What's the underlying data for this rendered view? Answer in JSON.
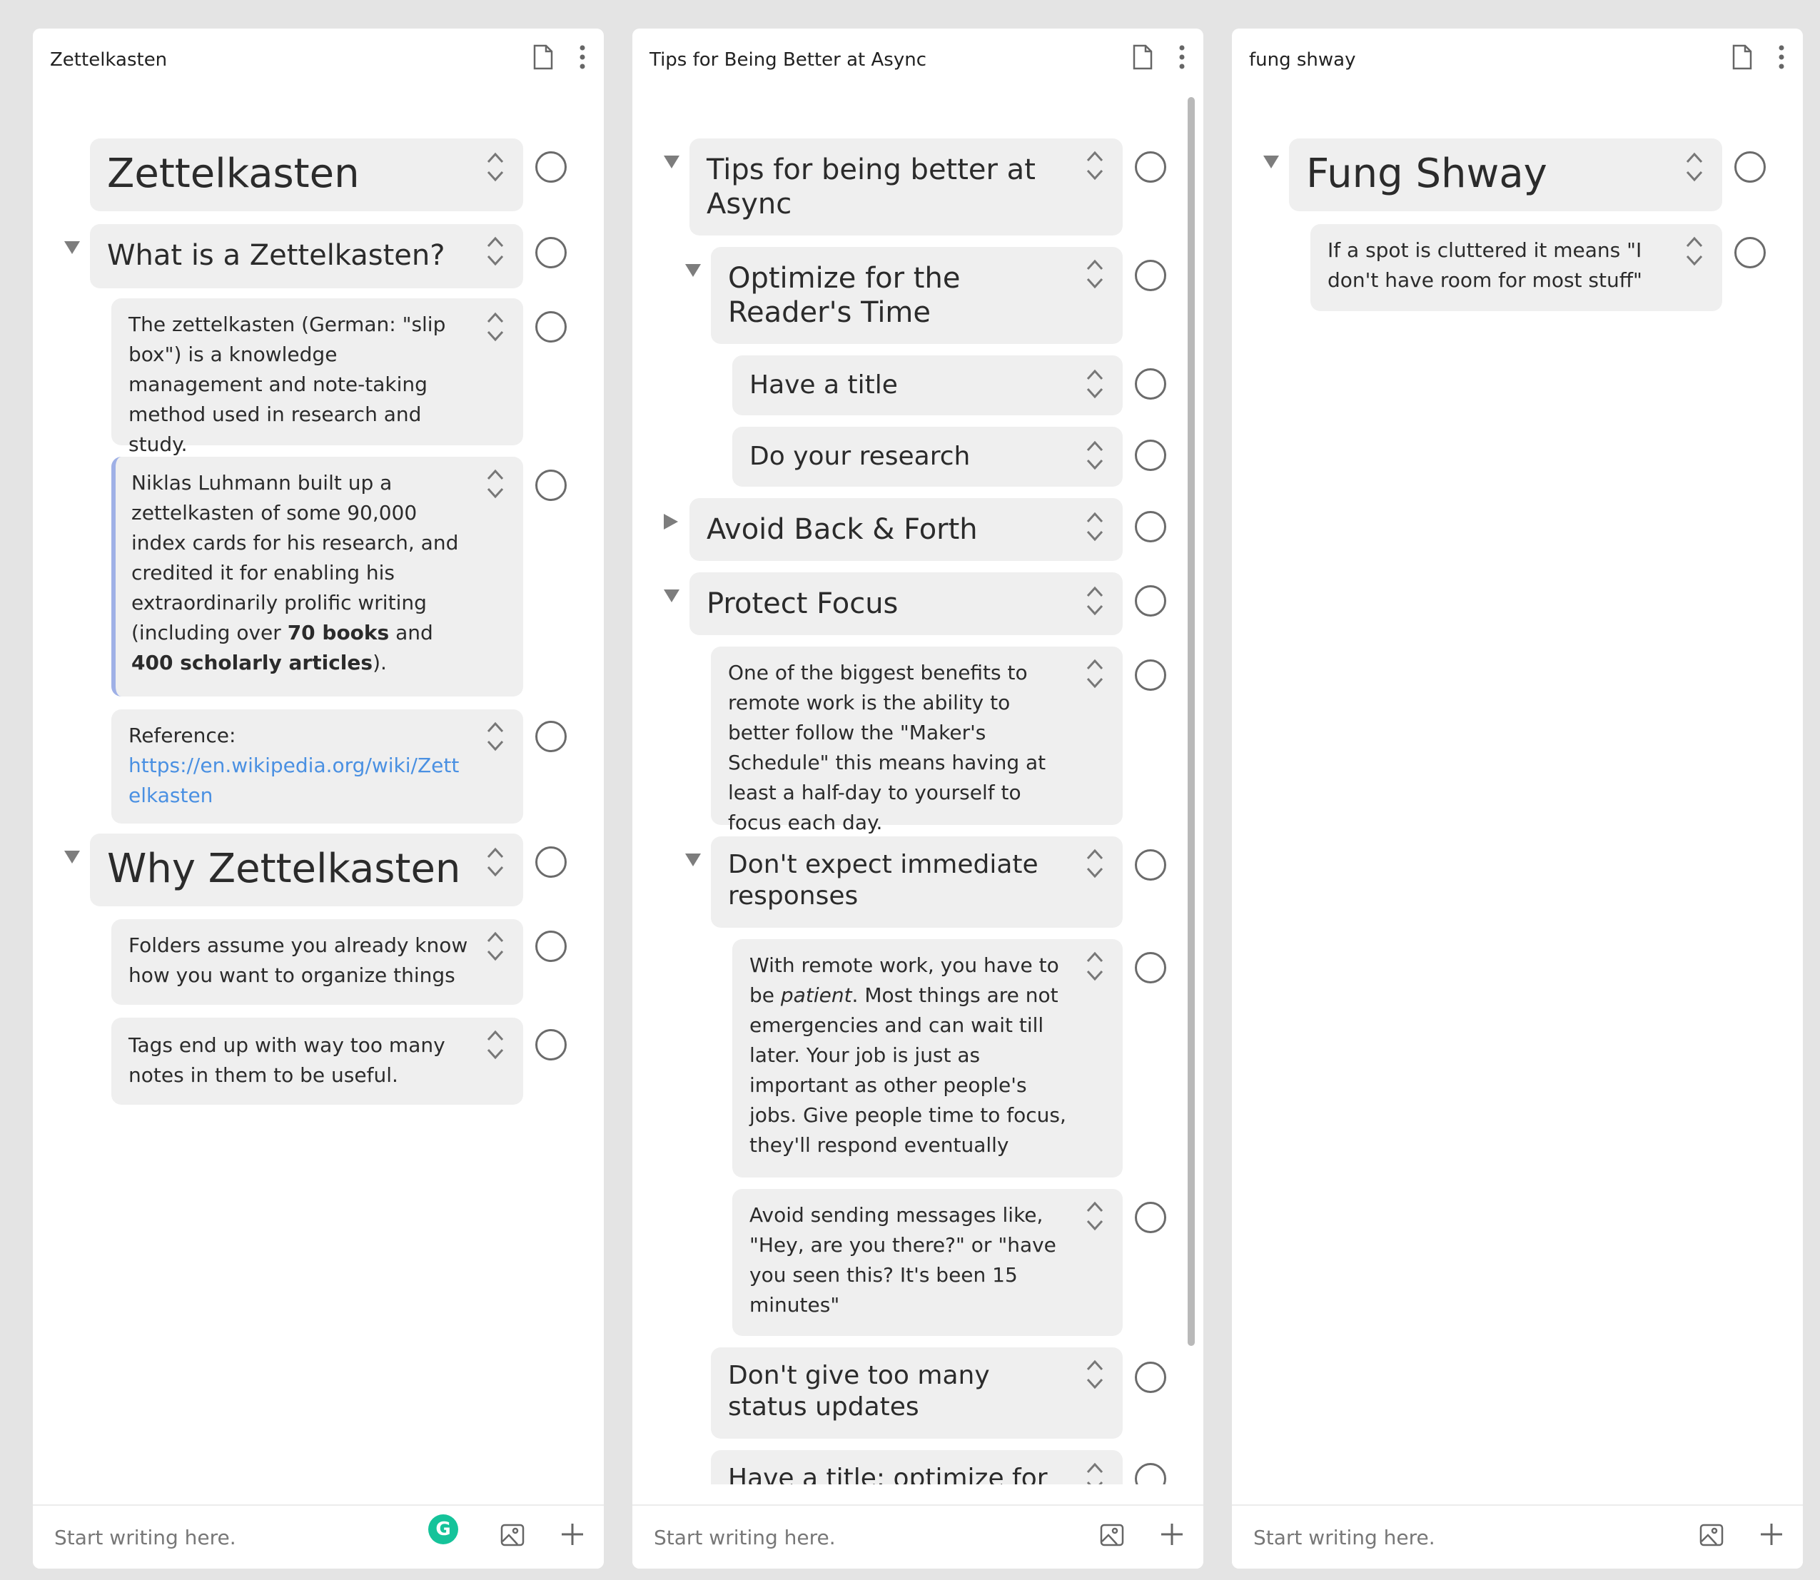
{
  "panels": [
    {
      "title": "Zettelkasten",
      "footer_placeholder": "Start writing here.",
      "blocks": [
        {
          "text": "Zettelkasten"
        },
        {
          "text": "What is a Zettelkasten?"
        },
        {
          "text": "The zettelkasten (German: \"slip box\") is a knowledge management and note-taking method used in research and study."
        },
        {
          "text_parts": [
            "Niklas Luhmann built up a zettelkasten of some 90,000 index cards for his research, and credited it for enabling his extraordinarily prolific writing (including over ",
            "70 books",
            " and ",
            "400 scholarly articles",
            ")."
          ]
        },
        {
          "label": "Reference:",
          "link": "https://en.wikipedia.org/wiki/Zettelkasten"
        },
        {
          "text": "Why Zettelkasten"
        },
        {
          "text": "Folders assume you already know how you want to organize things"
        },
        {
          "text": "Tags end up with way too many notes in them to be useful."
        }
      ]
    },
    {
      "title": "Tips for Being Better at Async",
      "footer_placeholder": "Start writing here.",
      "blocks": [
        {
          "text": "Tips for being better at Async"
        },
        {
          "text": "Optimize for the Reader's Time"
        },
        {
          "text": "Have a title"
        },
        {
          "text": "Do your research"
        },
        {
          "text": "Avoid Back & Forth"
        },
        {
          "text": "Protect Focus"
        },
        {
          "text": "One of the biggest benefits to remote work is the ability to better follow the \"Maker's Schedule\" this means having at least a half-day to yourself to focus each day."
        },
        {
          "text": "Don't expect immediate responses"
        },
        {
          "text_parts": [
            "With remote work, you have to be ",
            "patient",
            ". Most things are not emergencies and can wait till later. Your job is just as important as other people's jobs. Give people time to focus, they'll respond eventually"
          ]
        },
        {
          "text": "Avoid sending messages like, \"Hey, are you there?\" or \"have you seen this? It's been 15 minutes\""
        },
        {
          "text": "Don't give too many status updates"
        },
        {
          "text": "Have a title: optimize for the readers time"
        }
      ]
    },
    {
      "title": "fung shway",
      "footer_placeholder": "Start writing here.",
      "blocks": [
        {
          "text": "Fung Shway"
        },
        {
          "text": "If a spot is cluttered it means \"I don't have room for most stuff\""
        }
      ]
    }
  ],
  "grammarly_badge": "G",
  "icons": [
    "document-icon",
    "more-vertical-icon",
    "reorder-chevrons-icon",
    "completion-circle-icon",
    "collapse-triangle-icon",
    "image-icon",
    "plus-icon"
  ]
}
